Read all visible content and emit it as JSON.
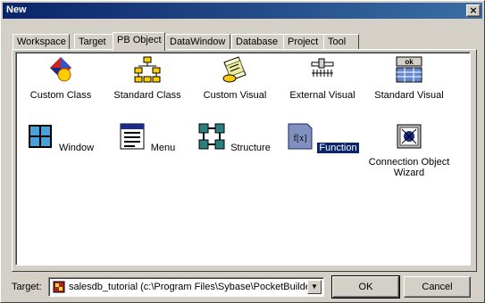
{
  "window": {
    "title": "New",
    "close_glyph": "×"
  },
  "tabs": [
    {
      "label": "Workspace"
    },
    {
      "label": "Target"
    },
    {
      "label": "PB Object",
      "active": true
    },
    {
      "label": "DataWindow"
    },
    {
      "label": "Database"
    },
    {
      "label": "Project"
    },
    {
      "label": "Tool"
    }
  ],
  "items": [
    {
      "label": "Custom Class",
      "icon": "custom-class-icon"
    },
    {
      "label": "Standard Class",
      "icon": "standard-class-icon"
    },
    {
      "label": "Custom Visual",
      "icon": "custom-visual-icon"
    },
    {
      "label": "External Visual",
      "icon": "external-visual-icon"
    },
    {
      "label": "Standard Visual",
      "icon": "standard-visual-icon",
      "icon_text": "ok"
    },
    {
      "label": "Window",
      "icon": "window-icon"
    },
    {
      "label": "Menu",
      "icon": "menu-icon"
    },
    {
      "label": "Structure",
      "icon": "structure-icon"
    },
    {
      "label": "Function",
      "icon": "function-icon",
      "icon_text": "f[x]",
      "selected": true
    },
    {
      "label": "Connection Object Wizard",
      "label_line1": "Connection Object",
      "label_line2": "Wizard",
      "icon": "connection-wizard-icon"
    }
  ],
  "footer": {
    "target_label": "Target:",
    "target_value": "salesdb_tutorial (c:\\Program Files\\Sybase\\PocketBuilder",
    "dropdown_glyph": "▼",
    "ok_label": "OK",
    "cancel_label": "Cancel"
  }
}
